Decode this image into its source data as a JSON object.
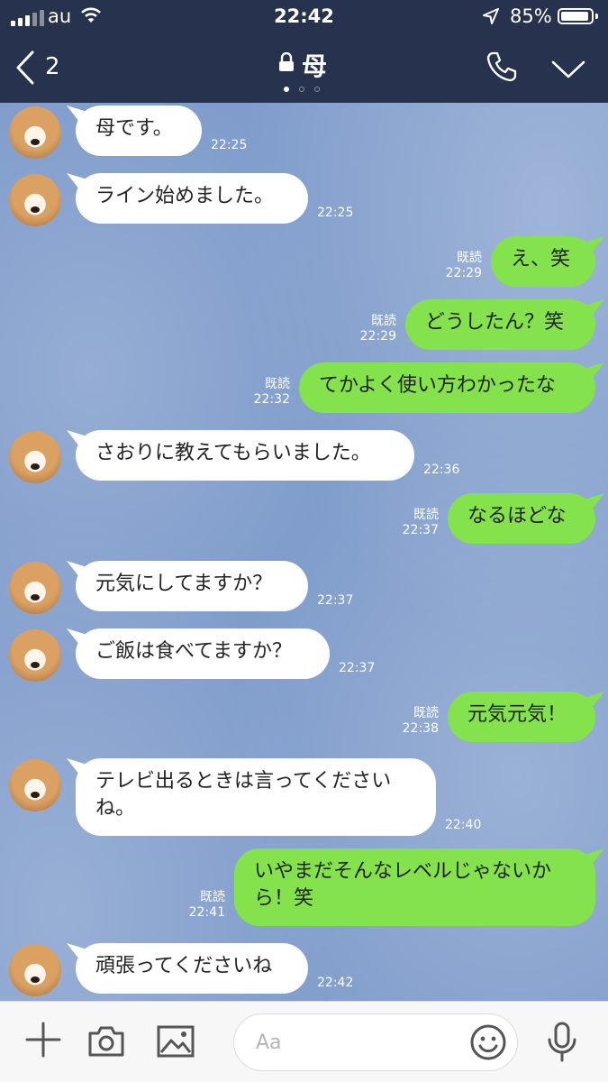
{
  "status": {
    "carrier": "au",
    "time": "22:42",
    "battery": "85%"
  },
  "header": {
    "back_count": "2",
    "title": "母",
    "page_dots": 3,
    "active_dot": 1
  },
  "messages": [
    {
      "side": "in",
      "lines": [
        "母です。"
      ],
      "time": "22:25"
    },
    {
      "side": "in",
      "lines": [
        "ライン始めました。"
      ],
      "time": "22:25"
    },
    {
      "side": "out",
      "lines": [
        "え、笑"
      ],
      "read": "既読",
      "time": "22:29"
    },
    {
      "side": "out",
      "lines": [
        "どうしたん？笑"
      ],
      "read": "既読",
      "time": "22:29"
    },
    {
      "side": "out",
      "lines": [
        "てかよく使い方わかったな"
      ],
      "read": "既読",
      "time": "22:32"
    },
    {
      "side": "in",
      "lines": [
        "さおりに教えてもらいました。"
      ],
      "time": "22:36"
    },
    {
      "side": "out",
      "lines": [
        "なるほどな"
      ],
      "read": "既読",
      "time": "22:37"
    },
    {
      "side": "in",
      "lines": [
        "元気にしてますか？"
      ],
      "time": "22:37"
    },
    {
      "side": "in",
      "lines": [
        "ご飯は食べてますか？"
      ],
      "time": "22:37"
    },
    {
      "side": "out",
      "lines": [
        "元気元気！"
      ],
      "read": "既読",
      "time": "22:38"
    },
    {
      "side": "in",
      "lines": [
        "テレビ出るときは言ってください",
        "ね。"
      ],
      "time": "22:40"
    },
    {
      "side": "out",
      "lines": [
        "いやまだそんなレベルじゃないか",
        "ら！笑"
      ],
      "read": "既読",
      "time": "22:41"
    },
    {
      "side": "in",
      "lines": [
        "頑張ってくださいね"
      ],
      "time": "22:42"
    }
  ],
  "composer": {
    "placeholder": "Aa"
  },
  "colors": {
    "header": "#26324e",
    "chat_bg": "#7f9ccb",
    "outgoing": "#84e24d",
    "incoming": "#ffffff"
  },
  "icons": [
    "back-chevron-icon",
    "lock-icon",
    "phone-icon",
    "chevron-down-icon",
    "plus-icon",
    "camera-icon",
    "image-icon",
    "emoji-icon",
    "microphone-icon"
  ]
}
